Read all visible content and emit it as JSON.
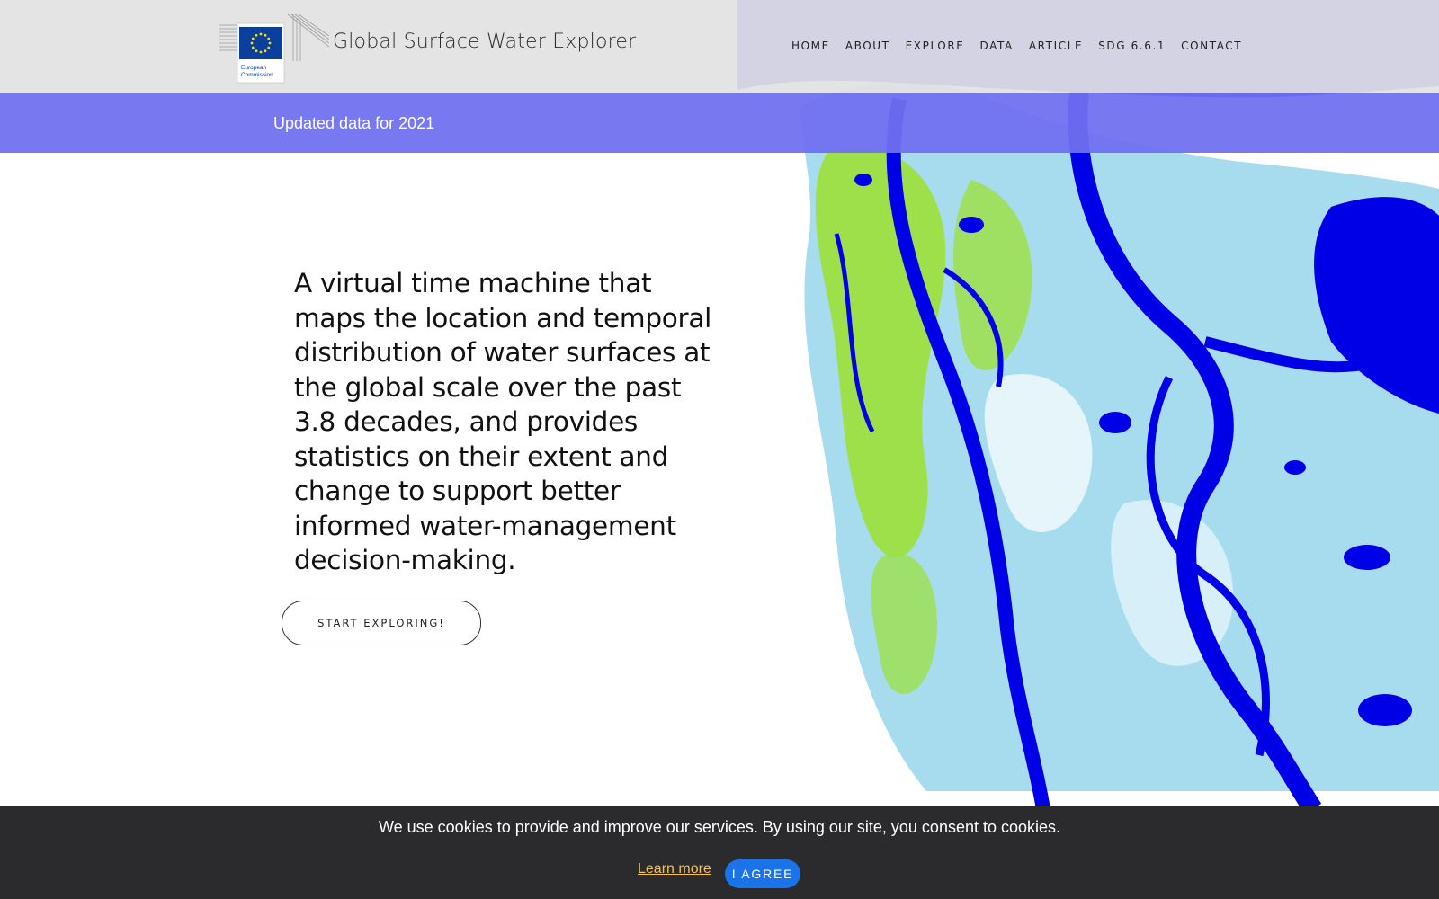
{
  "header": {
    "logo_text_line1": "European",
    "logo_text_line2": "Commission",
    "site_title": "Global Surface Water Explorer",
    "nav": [
      "HOME",
      "ABOUT",
      "EXPLORE",
      "DATA",
      "ARTICLE",
      "SDG 6.6.1",
      "CONTACT"
    ]
  },
  "banner": {
    "text": "Updated data for 2021"
  },
  "hero": {
    "tagline": "A virtual time machine that maps the location and temporal distribution of water surfaces at the global scale over the past 3.8 decades, and provides statistics on their extent and change to support better informed water-management decision-making.",
    "cta_label": "START EXPLORING!"
  },
  "cookie_bar": {
    "message": "We use cookies to provide and improve our services. By using our site, you consent to cookies.",
    "learn_more": "Learn more",
    "agree": "I AGREE"
  },
  "colors": {
    "banner": "#7070f0",
    "water_permanent": "#0000e6",
    "water_seasonal": "#99d9ea",
    "water_new": "#9ee04a",
    "cookie_bg": "#2b2b2d",
    "agree_button": "#1a73e8",
    "learn_link": "#f5c14a"
  }
}
